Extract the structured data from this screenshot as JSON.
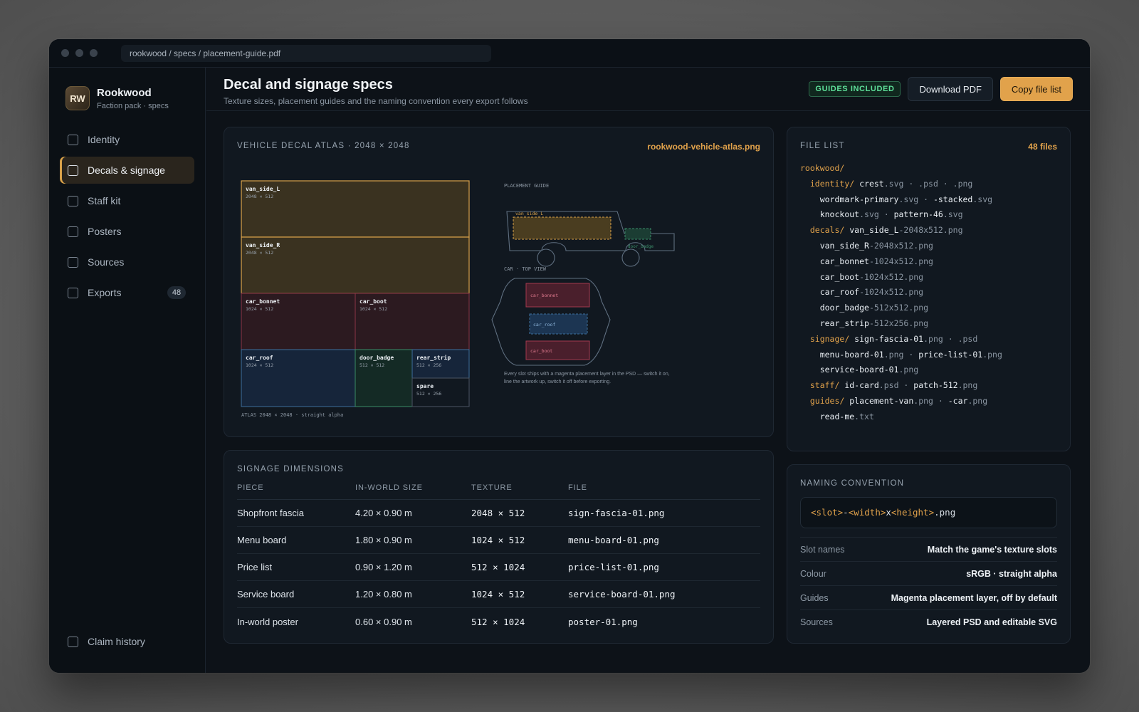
{
  "window": {
    "url": "rookwood / specs / placement-guide.pdf"
  },
  "brand": {
    "initials": "RW",
    "name": "Rookwood",
    "subtitle": "Faction pack · specs"
  },
  "nav": {
    "items": [
      {
        "label": "Identity"
      },
      {
        "label": "Decals & signage",
        "active": true
      },
      {
        "label": "Staff kit"
      },
      {
        "label": "Posters"
      },
      {
        "label": "Sources"
      },
      {
        "label": "Exports",
        "count": "48"
      }
    ],
    "bottom": {
      "label": "Claim history"
    }
  },
  "header": {
    "title": "Decal and signage specs",
    "subtitle": "Texture sizes, placement guides and the naming convention every export follows",
    "badge": "GUIDES INCLUDED",
    "download_label": "Download PDF",
    "copy_label": "Copy file list"
  },
  "atlas": {
    "title": "VEHICLE DECAL ATLAS · 2048 × 2048",
    "file": "rookwood-vehicle-atlas.png",
    "footer": "ATLAS 2048 × 2048 · straight alpha",
    "slots": [
      {
        "name": "van_side_L",
        "size": "2048 × 512"
      },
      {
        "name": "van_side_R",
        "size": "2048 × 512"
      },
      {
        "name": "car_bonnet",
        "size": "1024 × 512"
      },
      {
        "name": "car_boot",
        "size": "1024 × 512"
      },
      {
        "name": "car_roof",
        "size": "1024 × 512"
      },
      {
        "name": "door_badge",
        "size": "512 × 512"
      },
      {
        "name": "rear_strip",
        "size": "512 × 256"
      },
      {
        "name": "spare",
        "size": "512 × 256"
      }
    ],
    "guide": {
      "title": "PLACEMENT GUIDE",
      "van_label": "van_side_L",
      "badge_label": "door_badge",
      "car_title": "CAR · TOP VIEW",
      "car_labels": [
        "car_bonnet",
        "car_roof",
        "car_boot"
      ],
      "note_line1": "Every slot ships with a magenta placement layer in the PSD — switch it on,",
      "note_line2": "line the artwork up, switch it off before exporting."
    },
    "colors": {
      "van": "#d9a24a",
      "car_red": "#a33a4e",
      "car_blue": "#3d6f9c",
      "green": "#3a8c68"
    }
  },
  "file_list": {
    "title": "FILE LIST",
    "count": "48 files",
    "lines": [
      [
        {
          "t": "rookwood/",
          "c": "dir"
        }
      ],
      [
        {
          "t": "  "
        },
        {
          "t": "identity/",
          "c": "dir"
        },
        {
          "t": " crest",
          "c": "name"
        },
        {
          "t": ".svg · .psd · .png",
          "c": "ext"
        }
      ],
      [
        {
          "t": "    "
        },
        {
          "t": "wordmark-primary",
          "c": "name"
        },
        {
          "t": ".svg · ",
          "c": "ext"
        },
        {
          "t": "-stacked",
          "c": "name"
        },
        {
          "t": ".svg",
          "c": "ext"
        }
      ],
      [
        {
          "t": "    "
        },
        {
          "t": "knockout",
          "c": "name"
        },
        {
          "t": ".svg · ",
          "c": "ext"
        },
        {
          "t": "pattern-46",
          "c": "name"
        },
        {
          "t": ".svg",
          "c": "ext"
        }
      ],
      [
        {
          "t": "  "
        },
        {
          "t": "decals/",
          "c": "dir"
        },
        {
          "t": " van_side_L",
          "c": "name"
        },
        {
          "t": "-2048x512.png",
          "c": "ext"
        }
      ],
      [
        {
          "t": "    "
        },
        {
          "t": "van_side_R",
          "c": "name"
        },
        {
          "t": "-2048x512.png",
          "c": "ext"
        }
      ],
      [
        {
          "t": "    "
        },
        {
          "t": "car_bonnet",
          "c": "name"
        },
        {
          "t": "-1024x512.png",
          "c": "ext"
        }
      ],
      [
        {
          "t": "    "
        },
        {
          "t": "car_boot",
          "c": "name"
        },
        {
          "t": "-1024x512.png",
          "c": "ext"
        }
      ],
      [
        {
          "t": "    "
        },
        {
          "t": "car_roof",
          "c": "name"
        },
        {
          "t": "-1024x512.png",
          "c": "ext"
        }
      ],
      [
        {
          "t": "    "
        },
        {
          "t": "door_badge",
          "c": "name"
        },
        {
          "t": "-512x512.png",
          "c": "ext"
        }
      ],
      [
        {
          "t": "    "
        },
        {
          "t": "rear_strip",
          "c": "name"
        },
        {
          "t": "-512x256.png",
          "c": "ext"
        }
      ],
      [
        {
          "t": "  "
        },
        {
          "t": "signage/",
          "c": "dir"
        },
        {
          "t": " sign-fascia-01",
          "c": "name"
        },
        {
          "t": ".png · .psd",
          "c": "ext"
        }
      ],
      [
        {
          "t": "    "
        },
        {
          "t": "menu-board-01",
          "c": "name"
        },
        {
          "t": ".png · ",
          "c": "ext"
        },
        {
          "t": "price-list-01",
          "c": "name"
        },
        {
          "t": ".png",
          "c": "ext"
        }
      ],
      [
        {
          "t": "    "
        },
        {
          "t": "service-board-01",
          "c": "name"
        },
        {
          "t": ".png",
          "c": "ext"
        }
      ],
      [
        {
          "t": "  "
        },
        {
          "t": "staff/",
          "c": "dir"
        },
        {
          "t": " id-card",
          "c": "name"
        },
        {
          "t": ".psd · ",
          "c": "ext"
        },
        {
          "t": "patch-512",
          "c": "name"
        },
        {
          "t": ".png",
          "c": "ext"
        }
      ],
      [
        {
          "t": "  "
        },
        {
          "t": "guides/",
          "c": "dir"
        },
        {
          "t": " placement-van",
          "c": "name"
        },
        {
          "t": ".png · ",
          "c": "ext"
        },
        {
          "t": "-car",
          "c": "name"
        },
        {
          "t": ".png",
          "c": "ext"
        }
      ],
      [
        {
          "t": "    "
        },
        {
          "t": "read-me",
          "c": "name"
        },
        {
          "t": ".txt",
          "c": "ext"
        }
      ]
    ]
  },
  "signage": {
    "title": "SIGNAGE DIMENSIONS",
    "columns": [
      "PIECE",
      "IN-WORLD SIZE",
      "TEXTURE",
      "FILE"
    ],
    "rows": [
      [
        "Shopfront fascia",
        "4.20 × 0.90 m",
        "2048 × 512",
        "sign-fascia-01.png"
      ],
      [
        "Menu board",
        "1.80 × 0.90 m",
        "1024 × 512",
        "menu-board-01.png"
      ],
      [
        "Price list",
        "0.90 × 1.20 m",
        "512 × 1024",
        "price-list-01.png"
      ],
      [
        "Service board",
        "1.20 × 0.80 m",
        "1024 × 512",
        "service-board-01.png"
      ],
      [
        "In-world poster",
        "0.60 × 0.90 m",
        "512 × 1024",
        "poster-01.png"
      ]
    ]
  },
  "naming": {
    "title": "NAMING CONVENTION",
    "pattern": [
      {
        "t": "<slot>",
        "c": "var"
      },
      {
        "t": "-"
      },
      {
        "t": "<width>",
        "c": "var"
      },
      {
        "t": "x"
      },
      {
        "t": "<height>",
        "c": "var"
      },
      {
        "t": ".png"
      }
    ],
    "rows": [
      {
        "k": "Slot names",
        "v": "Match the game's texture slots"
      },
      {
        "k": "Colour",
        "v": "sRGB · straight alpha"
      },
      {
        "k": "Guides",
        "v": "Magenta placement layer, off by default"
      },
      {
        "k": "Sources",
        "v": "Layered PSD and editable SVG"
      }
    ]
  }
}
